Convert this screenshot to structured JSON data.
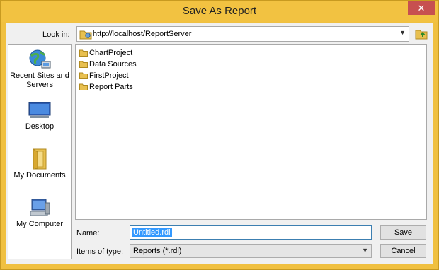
{
  "window": {
    "title": "Save As Report",
    "close_glyph": "✕"
  },
  "lookin": {
    "label": "Look in:",
    "value": "http://localhost/ReportServer"
  },
  "places": [
    {
      "label": "Recent Sites and Servers",
      "icon": "globe-network-icon"
    },
    {
      "label": "Desktop",
      "icon": "desktop-icon"
    },
    {
      "label": "My Documents",
      "icon": "documents-folder-icon"
    },
    {
      "label": "My Computer",
      "icon": "computer-icon"
    }
  ],
  "files": [
    {
      "name": "ChartProject"
    },
    {
      "name": "Data Sources"
    },
    {
      "name": "FirstProject"
    },
    {
      "name": "Report Parts"
    }
  ],
  "name_field": {
    "label": "Name:",
    "value": "Untitled.rdl"
  },
  "type_field": {
    "label": "Items of type:",
    "value": "Reports (*.rdl)"
  },
  "buttons": {
    "save": "Save",
    "cancel": "Cancel"
  },
  "colors": {
    "title_bar": "#f2c241",
    "close_button": "#c75050",
    "selection": "#3399ff",
    "folder": "#e8c050"
  }
}
